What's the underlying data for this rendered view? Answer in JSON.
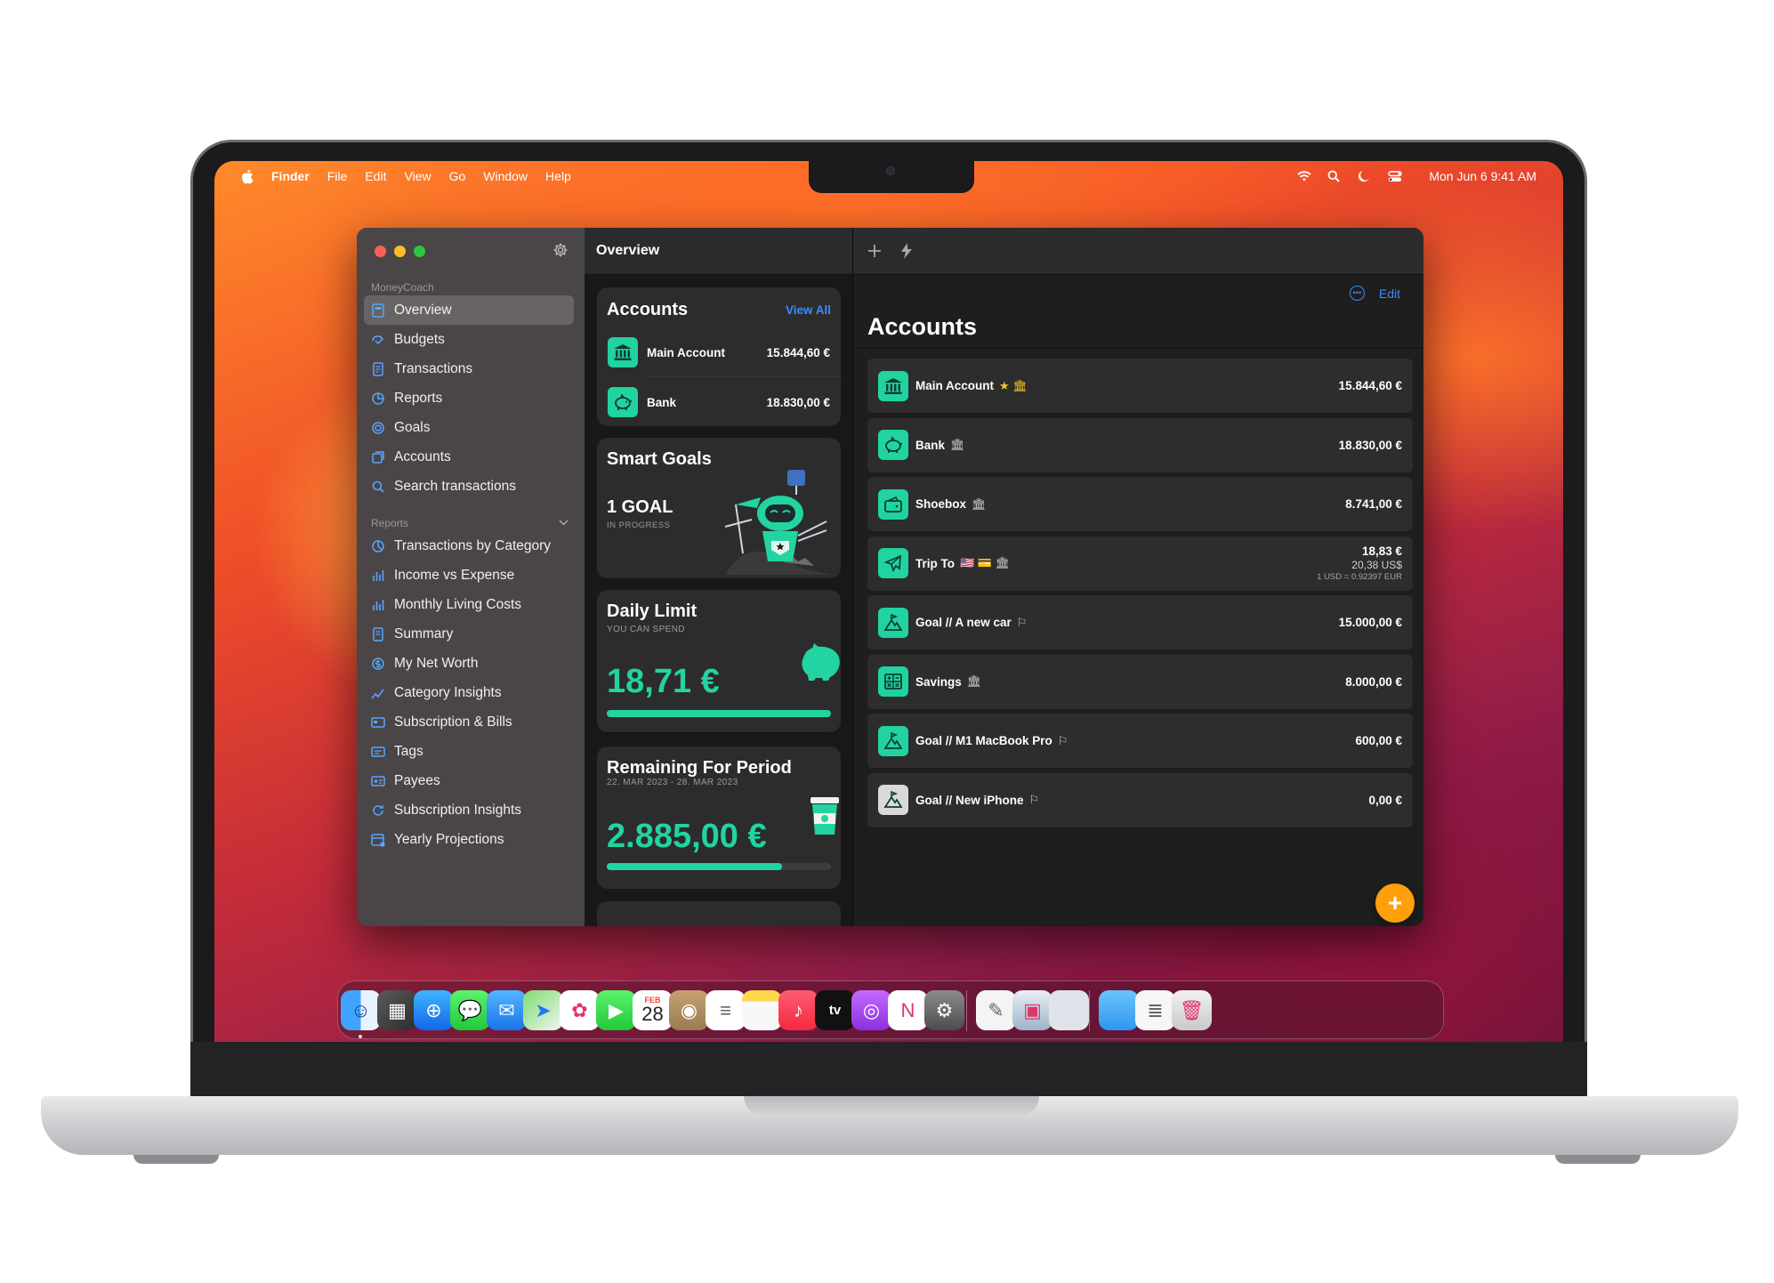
{
  "menubar": {
    "app": "Finder",
    "items": [
      "File",
      "Edit",
      "View",
      "Go",
      "Window",
      "Help"
    ],
    "clock": "Mon Jun 6  9:41 AM"
  },
  "sidebar": {
    "section_main": "MoneyCoach",
    "items_main": [
      {
        "label": "Overview",
        "icon": "overview-icon"
      },
      {
        "label": "Budgets",
        "icon": "budgets-icon"
      },
      {
        "label": "Transactions",
        "icon": "transactions-icon"
      },
      {
        "label": "Reports",
        "icon": "reports-icon"
      },
      {
        "label": "Goals",
        "icon": "goals-icon"
      },
      {
        "label": "Accounts",
        "icon": "accounts-icon"
      },
      {
        "label": "Search transactions",
        "icon": "search-icon"
      }
    ],
    "section_reports": "Reports",
    "items_reports": [
      {
        "label": "Transactions by Category",
        "icon": "pie-chart-icon"
      },
      {
        "label": "Income vs Expense",
        "icon": "bar-chart-icon"
      },
      {
        "label": "Monthly Living Costs",
        "icon": "bar-chart-icon"
      },
      {
        "label": "Summary",
        "icon": "document-icon"
      },
      {
        "label": "My Net Worth",
        "icon": "dollar-circle-icon"
      },
      {
        "label": "Category Insights",
        "icon": "line-chart-icon"
      },
      {
        "label": "Subscription & Bills",
        "icon": "card-icon"
      },
      {
        "label": "Tags",
        "icon": "tag-icon"
      },
      {
        "label": "Payees",
        "icon": "payee-icon"
      },
      {
        "label": "Subscription Insights",
        "icon": "refresh-icon"
      },
      {
        "label": "Yearly Projections",
        "icon": "calendar-icon"
      }
    ]
  },
  "middle": {
    "title": "Overview",
    "accounts_card": {
      "title": "Accounts",
      "view_all": "View All",
      "rows": [
        {
          "name": "Main Account",
          "amount": "15.844,60 €"
        },
        {
          "name": "Bank",
          "amount": "18.830,00 €"
        }
      ]
    },
    "goals_card": {
      "title": "Smart Goals",
      "count": "1 GOAL",
      "sub": "IN PROGRESS"
    },
    "daily_card": {
      "title": "Daily Limit",
      "sub": "YOU CAN SPEND",
      "amount": "18,71 €",
      "progress": 1.0
    },
    "remaining_card": {
      "title": "Remaining For Period",
      "sub": "22. MAR 2023 - 28. MAR 2023",
      "amount": "2.885,00 €",
      "progress": 0.78
    }
  },
  "detail": {
    "edit": "Edit",
    "title": "Accounts",
    "rows": [
      {
        "name": "Main Account",
        "badges": "★ 🏛",
        "amount": "15.844,60 €",
        "icon": "bank-icon"
      },
      {
        "name": "Bank",
        "badges": "🏛",
        "amount": "18.830,00 €",
        "icon": "piggy-bank-icon"
      },
      {
        "name": "Shoebox",
        "badges": "🏛",
        "amount": "8.741,00 €",
        "icon": "wallet-icon"
      },
      {
        "name": "Trip To",
        "badges": "🇺🇸 💳 🏛",
        "amount": "18,83 €",
        "amount2": "20,38 US$",
        "rate": "1 USD = 0.92397 EUR",
        "icon": "airplane-icon"
      },
      {
        "name": "Goal // A new car",
        "badges": "⚐",
        "amount": "15.000,00 €",
        "icon": "mountain-flag-icon"
      },
      {
        "name": "Savings",
        "badges": "🏛",
        "amount": "8.000,00 €",
        "icon": "calculator-icon"
      },
      {
        "name": "Goal // M1 MacBook Pro",
        "badges": "⚐",
        "amount": "600,00 €",
        "icon": "mountain-flag-icon"
      },
      {
        "name": "Goal // New iPhone",
        "badges": "⚐",
        "amount": "0,00 €",
        "icon": "mountain-flag-icon"
      }
    ]
  },
  "dock": {
    "calendar_month": "FEB",
    "calendar_day": "28",
    "apps": [
      "finder",
      "launchpad",
      "safari",
      "messages",
      "mail",
      "maps",
      "photos",
      "facetime",
      "calendar",
      "contacts",
      "reminders",
      "notes",
      "music",
      "tv",
      "podcasts",
      "news",
      "system-settings",
      "textedit",
      "preview",
      "blank-window",
      "folder",
      "document",
      "trash"
    ],
    "tv_label": "tv"
  },
  "colors": {
    "accent_green": "#21d4a2",
    "link_blue": "#3d8bff",
    "fab_orange": "#ff9f0a",
    "sidebar_bg": "#4a4647"
  }
}
